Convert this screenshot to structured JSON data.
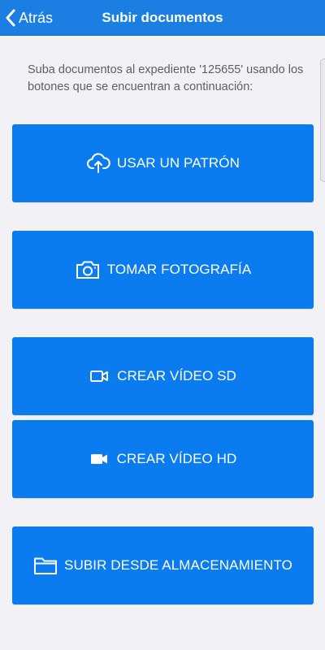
{
  "header": {
    "back_label": "Atrás",
    "title": "Subir documentos",
    "color": "#1a7ee3"
  },
  "description": "Suba documentos al expediente '125655' usando los botones que se encuentran a continuación:",
  "buttons": [
    {
      "label": "USAR UN PATRÓN",
      "icon": "cloud-upload-icon"
    },
    {
      "label": "TOMAR FOTOGRAFÍA",
      "icon": "camera-icon"
    },
    {
      "label": "CREAR VÍDEO SD",
      "icon": "video-outline-icon"
    },
    {
      "label": "CREAR VÍDEO HD",
      "icon": "video-filled-icon"
    },
    {
      "label": "SUBIR DESDE ALMACENAMIENTO",
      "icon": "folder-icon"
    }
  ],
  "colors": {
    "button": "#0a7cf0",
    "background": "#f2f1f6"
  }
}
